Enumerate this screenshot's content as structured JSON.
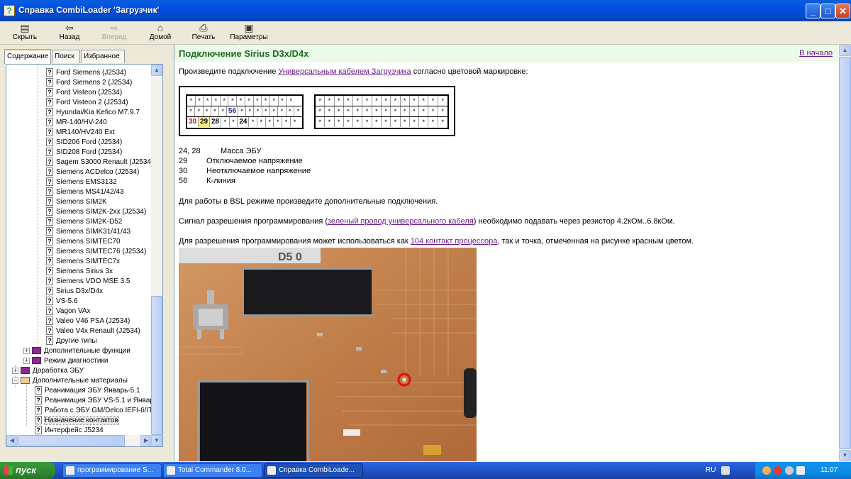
{
  "window": {
    "title": "Справка CombiLoader 'Загрузчик'",
    "controls": [
      "_",
      "□",
      "✕"
    ]
  },
  "toolbar": {
    "hide": "Скрыть",
    "back": "Назад",
    "forward": "Вперед",
    "home": "Домой",
    "print": "Печать",
    "options": "Параметры"
  },
  "nav_tabs": [
    "Содержание",
    "Поиск",
    "Избранное"
  ],
  "tree": {
    "pages": [
      "Ford Siemens (J2534)",
      "Ford Siemens 2 (J2534)",
      "Ford Visteon (J2534)",
      "Ford Visteon 2 (J2534)",
      "Hyundai/Kia Kefico M7.9.7",
      "MR-140/HV-240",
      "MR140/HV240 Ext",
      "SID206 Ford (J2534)",
      "SID208 Ford (J2534)",
      "Sagem S3000 Renault (J2534)",
      "Siemens ACDelco (J2534)",
      "Siemens EMS3132",
      "Siemens MS41/42/43",
      "Siemens SIM2K",
      "Siemens SIM2K-2xx (J2534)",
      "Siemens SIM2K-D52",
      "Siemens SIMK31/41/43",
      "Siemens SIMTEC70",
      "Siemens SIMTEC76 (J2534)",
      "Siemens SIMTEC7x",
      "Siemens Sirius 3x",
      "Siemens VDO MSE 3.5",
      "Sirius D3x/D4x",
      "VS-5.6",
      "Vagon VAx",
      "Valeo V46 PSA (J2534)",
      "Valeo V4x Renault (J2534)",
      "Другие типы"
    ],
    "book_extra": "Дополнительные функции",
    "book_diag": "Режим диагностики",
    "book_ecu": "Доработка ЭБУ",
    "book_materials": "Дополнительные материалы",
    "materials": [
      "Реанимация ЭБУ Январь-5.1",
      "Реанимация ЭБУ VS-5.1 и Январ",
      "Работа с ЭБУ GM/Delco IEFI-6/IT",
      "Назначение контактов",
      "Интерфейс J5234"
    ]
  },
  "content": {
    "title": "Подключение Sirius D3x/D4x",
    "to_top": "В начало",
    "intro_before": "Произведите подключение ",
    "intro_link": "Универсальным кабелем Загрузчика",
    "intro_after": " согласно цветовой маркировке:",
    "connector_left": {
      "row1": [
        "*",
        "*",
        "*",
        "*",
        "*",
        "*",
        "*",
        "*",
        "*",
        "*",
        "*",
        "*",
        "*"
      ],
      "row2": [
        "*",
        "*",
        "*",
        "*",
        "*",
        "56",
        "*",
        "*",
        "*",
        "*",
        "*",
        "*",
        "*",
        "*"
      ],
      "row3": [
        "30",
        "29",
        "28",
        "*",
        "*",
        "24",
        "*",
        "*",
        "*",
        "*",
        "*",
        "*"
      ]
    },
    "connector_right_mark": "*",
    "legend": [
      {
        "pins": "24, 28",
        "desc": "Масса ЭБУ"
      },
      {
        "pins": "29",
        "desc": "Отключаемое напряжение"
      },
      {
        "pins": "30",
        "desc": "Неотключаемое напряжение"
      },
      {
        "pins": "56",
        "desc": "К-линия"
      }
    ],
    "bsl_text": "Для работы в BSL режиме произведите дополнительные подключения.",
    "signal_before": "Сигнал разрешения программирования (",
    "signal_link": "зеленый провод универсального кабеля",
    "signal_after": ") необходимо подавать через резистор 4.2кОм..6.8кОм.",
    "enable_before": "Для разрешения программирования может использоваться как ",
    "enable_link": "104 контакт процессора",
    "enable_after": ", так и точка, отмеченная на рисунке красным цветом."
  },
  "taskbar": {
    "start": "пуск",
    "tasks": [
      "программирование S...",
      "Total Commander 8.0...",
      "Справка CombiLoade..."
    ],
    "lang": "RU",
    "clock": "11:07"
  }
}
